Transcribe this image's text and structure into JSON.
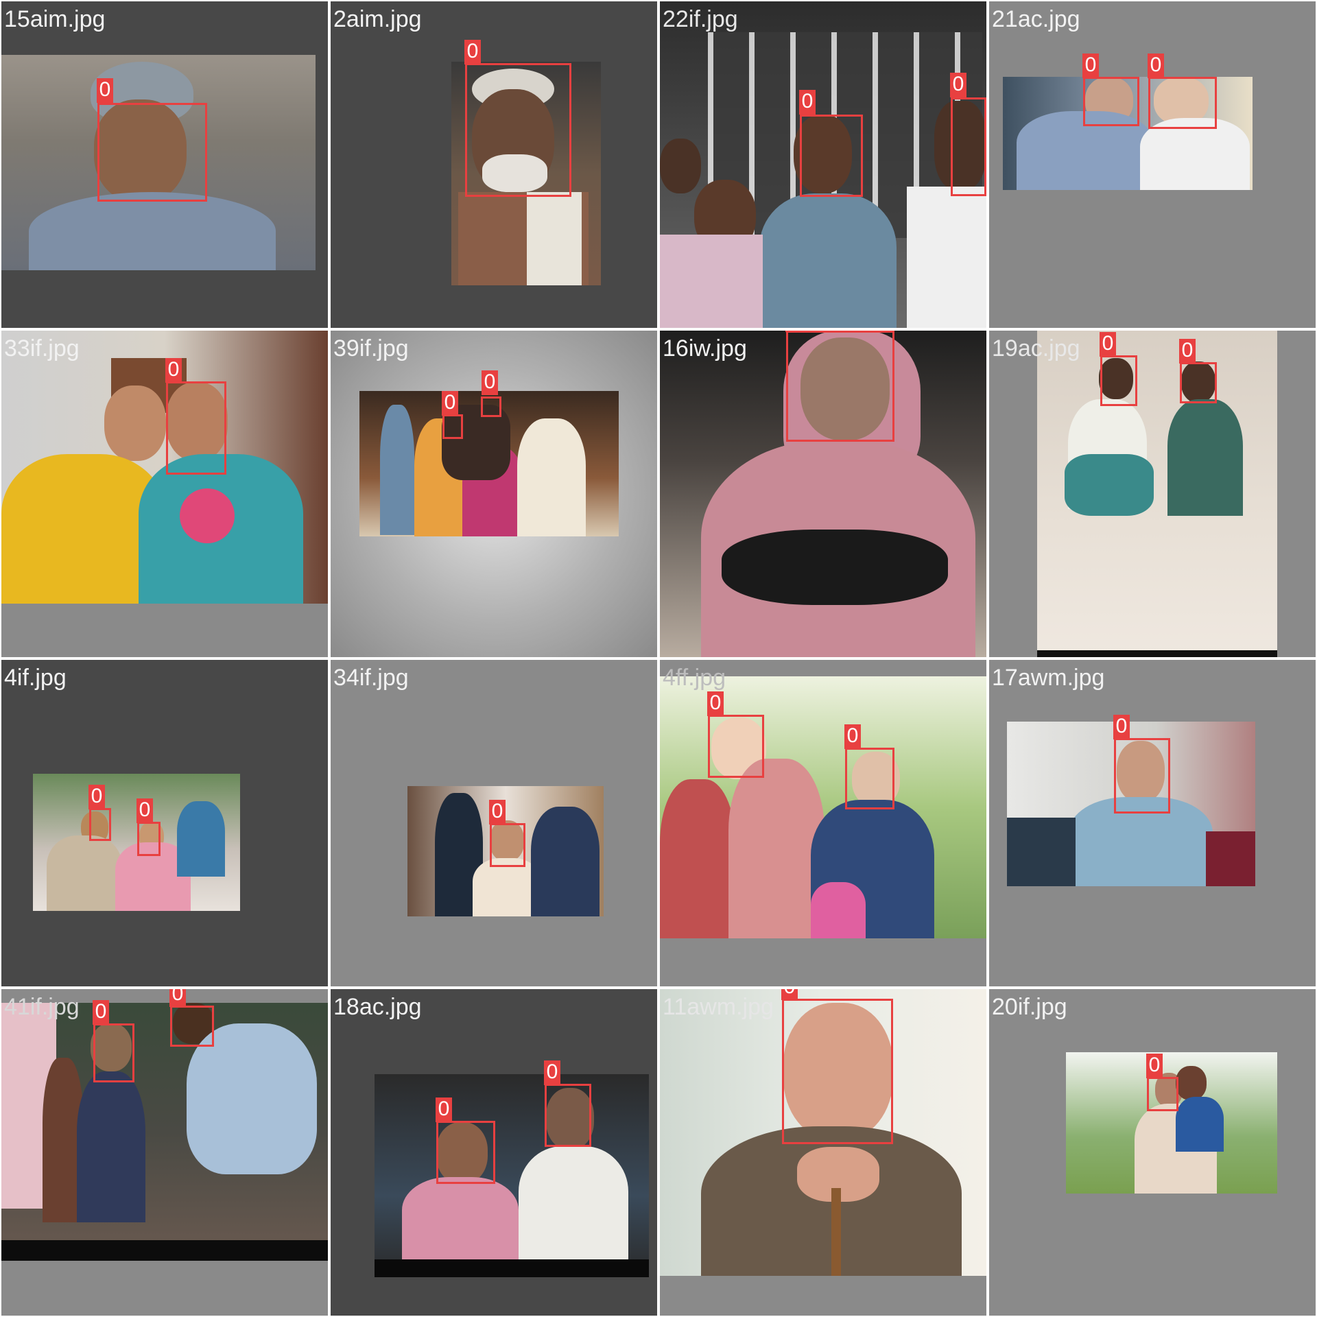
{
  "tiles": [
    {
      "name": "15aim.jpg",
      "label": "0"
    },
    {
      "name": "2aim.jpg",
      "label": "0"
    },
    {
      "name": "22if.jpg",
      "labels": [
        "0",
        "0"
      ]
    },
    {
      "name": "21ac.jpg",
      "labels": [
        "0",
        "0"
      ]
    },
    {
      "name": "33if.jpg",
      "label": "0"
    },
    {
      "name": "39if.jpg",
      "labels": [
        "0",
        "0"
      ]
    },
    {
      "name": "16iw.jpg",
      "label": "0"
    },
    {
      "name": "19ac.jpg",
      "labels": [
        "0",
        "0"
      ]
    },
    {
      "name": "4if.jpg",
      "labels": [
        "0",
        "0"
      ]
    },
    {
      "name": "34if.jpg",
      "label": "0"
    },
    {
      "name": "4ff.jpg",
      "labels": [
        "0",
        "0"
      ]
    },
    {
      "name": "17awm.jpg",
      "label": "0"
    },
    {
      "name": "41if.jpg",
      "labels": [
        "0",
        "0"
      ]
    },
    {
      "name": "18ac.jpg",
      "labels": [
        "0",
        "0"
      ]
    },
    {
      "name": "11awm.jpg",
      "label": "0"
    },
    {
      "name": "20if.jpg",
      "label": "0"
    }
  ],
  "colors": {
    "box": "#e84040",
    "dark_bg": "#4a4a4a",
    "mid_bg": "#8a8a8a"
  }
}
